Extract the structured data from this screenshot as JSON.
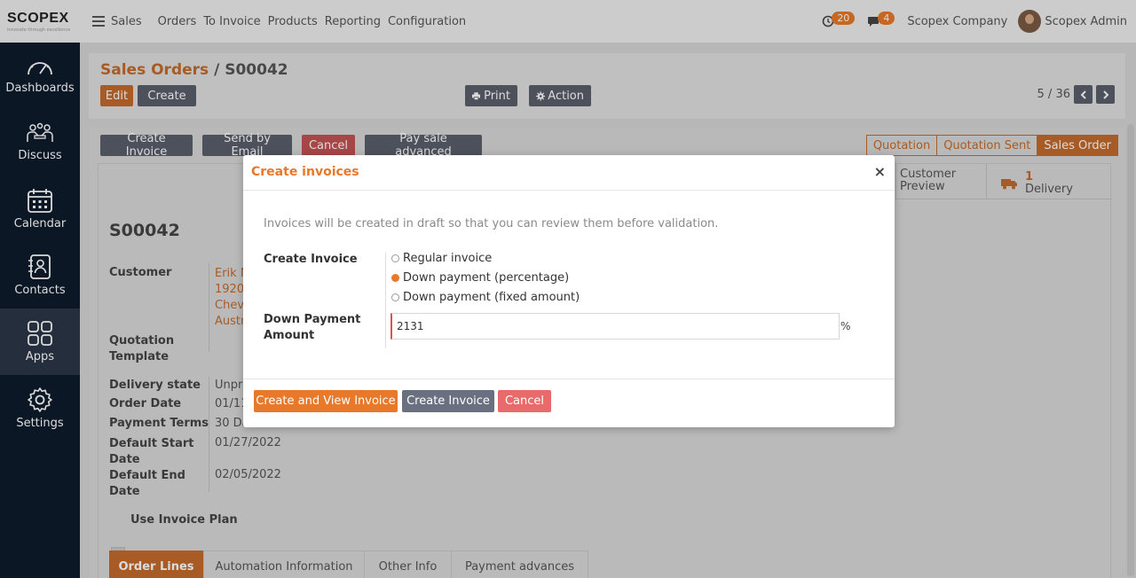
{
  "topbar": {
    "logo": "SCOPEX",
    "logo_tagline": "innovate through excellence",
    "app": "Sales",
    "menu": [
      "Orders",
      "To Invoice",
      "Products",
      "Reporting",
      "Configuration"
    ],
    "activity_count": "20",
    "messages_count": "4",
    "company": "Scopex Company",
    "user": "Scopex Admin"
  },
  "sidebar": {
    "items": [
      {
        "label": "Dashboards",
        "icon": "gauge-icon"
      },
      {
        "label": "Discuss",
        "icon": "people-icon"
      },
      {
        "label": "Calendar",
        "icon": "calendar-icon"
      },
      {
        "label": "Contacts",
        "icon": "contact-book-icon"
      },
      {
        "label": "Apps",
        "icon": "grid-icon"
      },
      {
        "label": "Settings",
        "icon": "gear-icon"
      }
    ]
  },
  "control": {
    "breadcrumb_parent": "Sales Orders",
    "breadcrumb_sep": "/",
    "breadcrumb_current": "S00042",
    "edit_label": "Edit",
    "create_label": "Create",
    "print_label": "Print",
    "action_label": "Action",
    "pager": "5 / 36"
  },
  "header_buttons": {
    "create_invoice": "Create Invoice",
    "send_email": "Send by Email",
    "cancel": "Cancel",
    "pay_advanced": "Pay sale advanced"
  },
  "statusbar": [
    "Quotation",
    "Quotation Sent",
    "Sales Order"
  ],
  "smart_buttons": {
    "customer_preview_1": "Customer",
    "customer_preview_2": "Preview",
    "delivery_count": "1",
    "delivery_label": "Delivery"
  },
  "form": {
    "name": "S00042",
    "customer_label": "Customer",
    "customer_lines": [
      "Erik N",
      "1920 D",
      "Chev",
      "Austr"
    ],
    "quotation_template_label_1": "Quotation",
    "quotation_template_label_2": "Template",
    "delivery_state_label": "Delivery state",
    "delivery_state_value": "Unpro",
    "order_date_label": "Order Date",
    "order_date_value": "01/11/",
    "payment_terms_label": "Payment Terms",
    "payment_terms_value": "30 Da",
    "default_start_label_1": "Default Start",
    "default_start_label_2": "Date",
    "default_start_value": "01/27/2022",
    "default_end_label_1": "Default End",
    "default_end_label_2": "Date",
    "default_end_value": "02/05/2022",
    "use_invoice_plan_label": "Use Invoice Plan"
  },
  "tabs": [
    "Order Lines",
    "Automation Information",
    "Other Info",
    "Payment advances"
  ],
  "modal": {
    "title": "Create invoices",
    "close": "×",
    "hint": "Invoices will be created in draft so that you can review them before validation.",
    "create_invoice_label": "Create Invoice",
    "options": [
      "Regular invoice",
      "Down payment (percentage)",
      "Down payment (fixed amount)"
    ],
    "selected_option": 1,
    "down_payment_label_1": "Down Payment",
    "down_payment_label_2": "Amount",
    "down_payment_value": "2131",
    "unit": "%",
    "btn_create_view": "Create and View Invoice",
    "btn_create": "Create Invoice",
    "btn_cancel": "Cancel"
  },
  "colors": {
    "accent": "#e8782a",
    "sidebar": "#0f1b2d",
    "danger": "#e86a6a",
    "secondary": "#6b7080"
  }
}
